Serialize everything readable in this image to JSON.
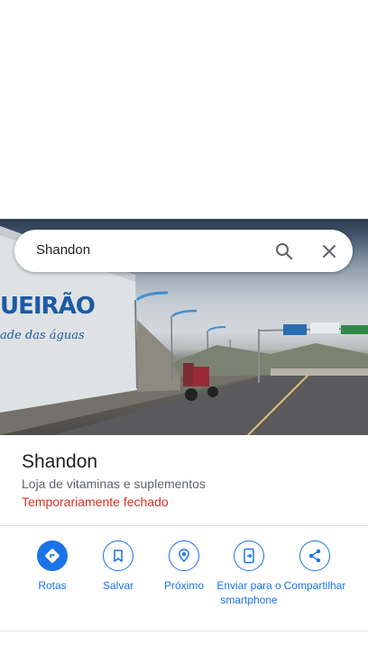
{
  "search": {
    "query": "Shandon"
  },
  "photo": {
    "building_sign": "UEIRÃO",
    "building_slogan": "ade das águas"
  },
  "place": {
    "name": "Shandon",
    "category": "Loja de vitaminas e suplementos",
    "status": "Temporariamente fechado"
  },
  "actions": [
    {
      "label": "Rotas",
      "icon": "directions-icon"
    },
    {
      "label": "Salvar",
      "icon": "bookmark-icon"
    },
    {
      "label": "Próximo",
      "icon": "nearby-icon"
    },
    {
      "label": "Enviar para o smartphone",
      "icon": "send-to-phone-icon"
    },
    {
      "label": "Compartilhar",
      "icon": "share-icon"
    }
  ],
  "colors": {
    "accent": "#1a73e8",
    "status_closed": "#d93025",
    "text": "#202124",
    "secondary_text": "#5f6368"
  }
}
